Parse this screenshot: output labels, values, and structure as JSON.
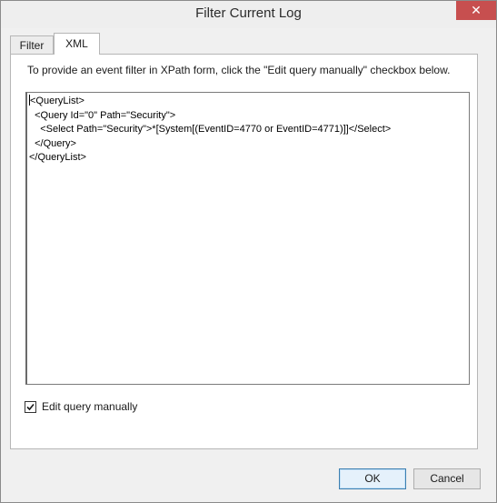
{
  "window": {
    "title": "Filter Current Log",
    "close_glyph": "✕"
  },
  "tabs": [
    {
      "label": "Filter",
      "selected": false
    },
    {
      "label": "XML",
      "selected": true
    }
  ],
  "xml_tab": {
    "instructions": "To provide an event filter in XPath form, click the \"Edit query manually\" checkbox below.",
    "query_lines": [
      "<QueryList>",
      "  <Query Id=\"0\" Path=\"Security\">",
      "    <Select Path=\"Security\">*[System[(EventID=4770 or EventID=4771)]]</Select>",
      "  </Query>",
      "</QueryList>"
    ],
    "edit_manually": {
      "label": "Edit query manually",
      "checked": true
    }
  },
  "buttons": {
    "ok": "OK",
    "cancel": "Cancel"
  },
  "colors": {
    "close_button": "#c74f4f",
    "default_button_border": "#3c7fb1"
  }
}
